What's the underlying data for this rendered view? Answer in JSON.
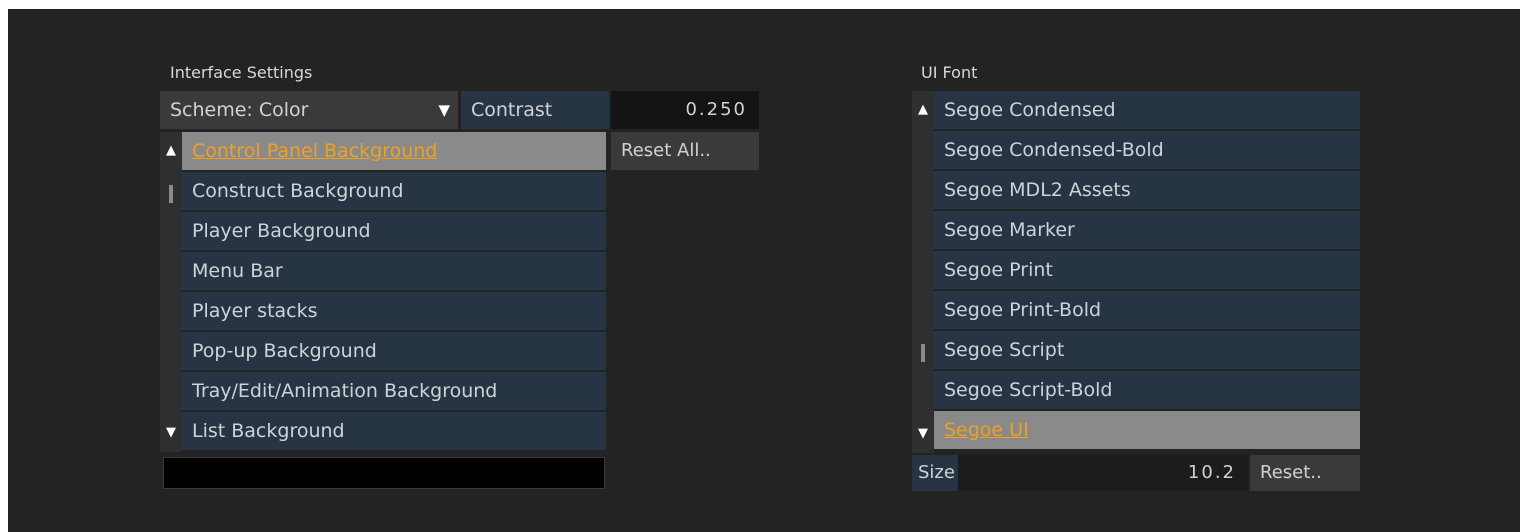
{
  "interface_settings": {
    "title": "Interface Settings",
    "scheme_label": "Scheme: Color",
    "scheme_arrow": "▼",
    "contrast_label": "Contrast",
    "contrast_value": "0.250",
    "reset_all_label": "Reset All..",
    "items": [
      "Control Panel Background",
      "Construct Background",
      "Player Background",
      "Menu Bar",
      "Player stacks",
      "Pop-up Background",
      "Tray/Edit/Animation Background",
      "List Background"
    ],
    "selected_item": "Control Panel Background",
    "color_swatch": "#000000"
  },
  "ui_font": {
    "title": "UI Font",
    "items": [
      "Segoe Condensed",
      "Segoe Condensed-Bold",
      "Segoe MDL2 Assets",
      "Segoe Marker",
      "Segoe Print",
      "Segoe Print-Bold",
      "Segoe Script",
      "Segoe Script-Bold",
      "Segoe UI"
    ],
    "selected_item": "Segoe UI",
    "size_label": "Size",
    "size_value": "10.2",
    "reset_label": "Reset.."
  },
  "scroll_icons": {
    "up": "▲",
    "down": "▼"
  },
  "colors": {
    "panel_bg": "#232323",
    "row_bg": "#273443",
    "selected_bg": "#8a8a8a",
    "selected_text": "#f0a020",
    "text": "#cfd3d7"
  }
}
